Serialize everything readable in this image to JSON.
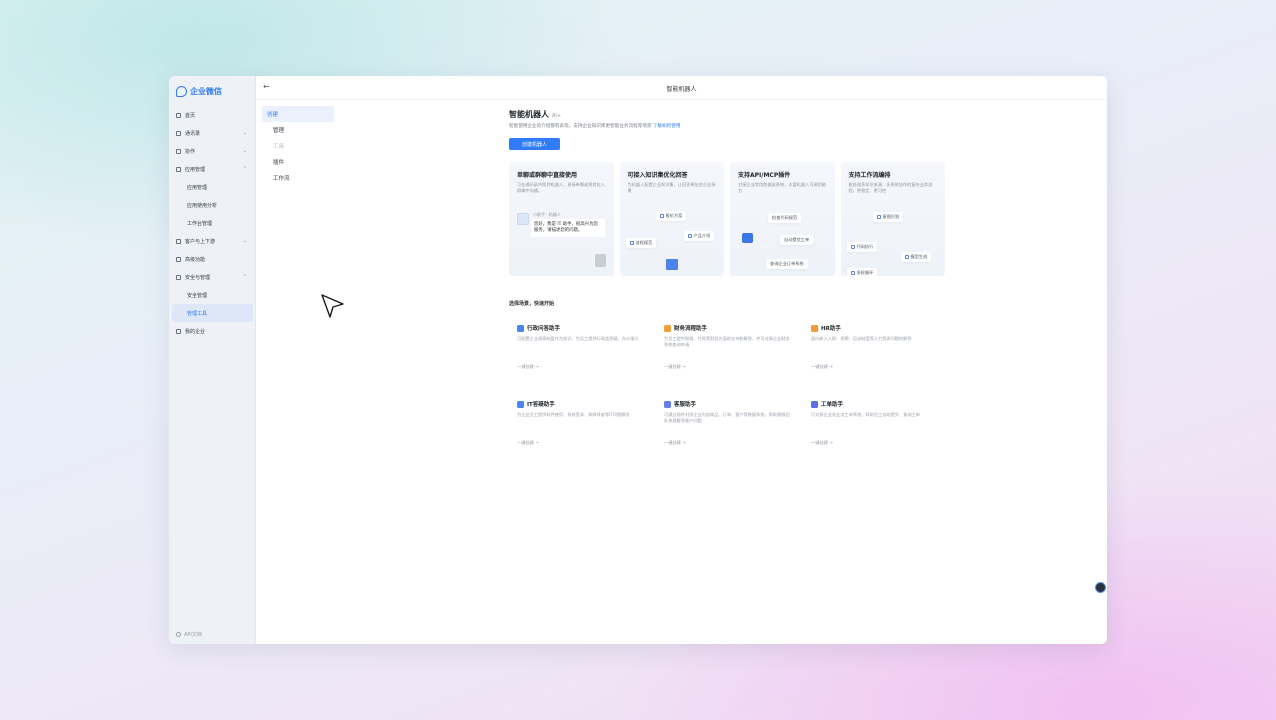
{
  "app": {
    "logo_text": "企业微信",
    "window_title": "智能机器人"
  },
  "sidebar": {
    "items": [
      {
        "label": "首页",
        "icon": "home-icon",
        "sub": false,
        "chevron": ""
      },
      {
        "label": "通讯录",
        "icon": "contacts-icon",
        "sub": false,
        "chevron": "⌄"
      },
      {
        "label": "协作",
        "icon": "collab-icon",
        "sub": false,
        "chevron": "⌄"
      },
      {
        "label": "应用管理",
        "icon": "apps-icon",
        "sub": false,
        "chevron": "⌃"
      },
      {
        "label": "应用管理",
        "icon": "",
        "sub": true,
        "chevron": ""
      },
      {
        "label": "应用使用分析",
        "icon": "",
        "sub": true,
        "chevron": ""
      },
      {
        "label": "工作台管理",
        "icon": "",
        "sub": true,
        "chevron": ""
      },
      {
        "label": "客户与上下游",
        "icon": "customer-icon",
        "sub": false,
        "chevron": "⌄"
      },
      {
        "label": "高级功能",
        "icon": "advanced-icon",
        "sub": false,
        "chevron": ""
      },
      {
        "label": "安全与管理",
        "icon": "security-icon",
        "sub": false,
        "chevron": "⌃"
      },
      {
        "label": "安全管理",
        "icon": "",
        "sub": true,
        "chevron": ""
      },
      {
        "label": "管理工具",
        "icon": "",
        "sub": true,
        "chevron": "",
        "active": true
      },
      {
        "label": "我的企业",
        "icon": "company-icon",
        "sub": false,
        "chevron": ""
      }
    ],
    "footer": "API文档"
  },
  "subnav": {
    "items": [
      {
        "label": "创建",
        "active": true,
        "dim": false
      },
      {
        "label": "管理",
        "active": false,
        "dim": false
      },
      {
        "label": "工具",
        "active": false,
        "dim": true
      },
      {
        "label": "插件",
        "active": false,
        "dim": false
      },
      {
        "label": "工作流",
        "active": false,
        "dim": false
      }
    ]
  },
  "main": {
    "title": "智能机器人",
    "title_tag": "AI+",
    "desc": "智能使用企业的介绍都有表现，支持企业知识库更智能业务流程等场景",
    "desc_link": "了解如何使用",
    "create_button": "创建机器人"
  },
  "features": [
    {
      "title": "单聊或群聊中直接使用",
      "desc": "可在通讯录内找到机器人，直接单聊或将其拉入群聊中沟通。",
      "bubble_name": "小助手 · 机器人",
      "bubble_text": "您好，我是 IT 助手，很高兴为您服务，请描述您的问题。"
    },
    {
      "title": "可接入知识集优化回答",
      "desc": "为机器人配置企业知识集，让回答更贴合企业场景",
      "chips": [
        "报价方案",
        "产品介绍",
        "流程规范"
      ]
    },
    {
      "title": "支持API/MCP插件",
      "desc": "对接企业常用数据或系统，丰富机器人可调用能力",
      "chips": [
        "检查代码规范",
        "自动提交工单",
        "查询企业订单系统"
      ]
    },
    {
      "title": "支持工作流编排",
      "desc": "能处理多知识来源、多系统协作的复杂业务流程，更稳定、更可控",
      "chips": [
        "意图识别",
        "代码执行",
        "模型生成",
        "多轮循环"
      ]
    }
  ],
  "scenes_title": "选择场景，快速开始",
  "scenes": [
    {
      "title": "行政问答助手",
      "desc": "可配置企业规章制度作为知识，为员工提供行政类答疑，办公指引",
      "link": "一键创建 →",
      "color": "#4a86f0"
    },
    {
      "title": "财务流程助手",
      "desc": "为员工提供报销、付款等财务方面的支持和解答，并可对接企业财务系统查询申请",
      "link": "一键创建 →",
      "color": "#f0a23a"
    },
    {
      "title": "HR助手",
      "desc": "面向新人入职、招聘、培训制度等人力资源问题的解答",
      "link": "一键创建 →",
      "color": "#f39a3b"
    },
    {
      "title": "IT答疑助手",
      "desc": "为企业员工提供软件使用、系统登录、故障排查等IT问题解答",
      "link": "一键创建 →",
      "color": "#4a86f0"
    },
    {
      "title": "客服助手",
      "desc": "可通过插件对接企业内部商品、订单、客户等数据系统，帮助客服团队快速解答客户问题",
      "link": "一键创建 →",
      "color": "#6a7dea"
    },
    {
      "title": "工单助手",
      "desc": "可对接企业各业务工单系统，帮助员工自助提交、查询工单",
      "link": "一键创建 →",
      "color": "#5a6fe6"
    }
  ],
  "colors": {
    "accent": "#2f7cf6"
  }
}
